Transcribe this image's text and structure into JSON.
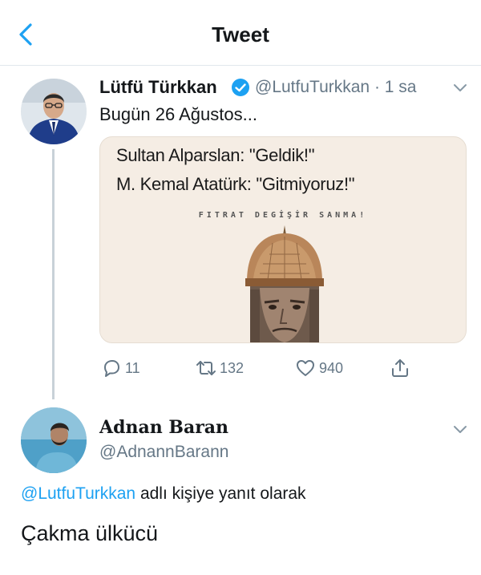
{
  "header": {
    "title": "Tweet",
    "back_icon": "chevron-left-icon"
  },
  "tweet": {
    "author_name": "Lütfü Türkkan",
    "verified_icon": "verified-badge-icon",
    "handle_time": "@LutfuTurkkan · 1 sa",
    "text": "Bugün 26 Ağustos...",
    "media": {
      "line1": "Sultan Alparslan: \"Geldik!\"",
      "line2": "M. Kemal Atatürk: \"Gitmiyoruz!\"",
      "caption": "FITRAT DEGİŞİR SANMA!"
    },
    "actions": {
      "replies": "11",
      "retweets": "132",
      "likes": "940"
    }
  },
  "reply": {
    "author_name": "Adnan Baran",
    "handle": "@AdnannBarann",
    "reply_to_mention": "@LutfuTurkkan",
    "reply_to_suffix": " adlı kişiye yanıt olarak",
    "text": "Çakma ülkücü"
  },
  "colors": {
    "accent": "#1da1f2",
    "secondary_text": "#657786",
    "divider": "#e1e8ed"
  }
}
